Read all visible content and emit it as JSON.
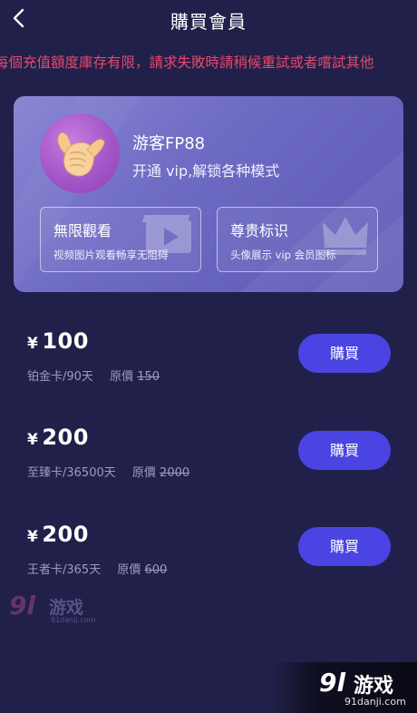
{
  "header": {
    "title": "購買會員",
    "back_icon": "chevron-left-icon"
  },
  "notice": "每個充值額度庫存有限，請求失敗時請稍候重試或者嚐試其他",
  "vip_card": {
    "user_name": "游客FP88",
    "description": "开通 vip,解锁各种模式",
    "avatar_icon": "hand-shaka-icon",
    "features": [
      {
        "title": "無限觀看",
        "desc": "视频图片观看畅享无阻碍",
        "icon": "film-icon"
      },
      {
        "title": "尊贵标识",
        "desc": "头像展示 vip 会员图标",
        "icon": "crown-icon"
      }
    ]
  },
  "plans": [
    {
      "currency": "¥",
      "price": "100",
      "name": "铂金卡/90天",
      "orig_label": "原價",
      "orig_price": "150",
      "button": "購買"
    },
    {
      "currency": "¥",
      "price": "200",
      "name": "至臻卡/36500天",
      "orig_label": "原價",
      "orig_price": "2000",
      "button": "購買"
    },
    {
      "currency": "¥",
      "price": "200",
      "name": "王者卡/365天",
      "orig_label": "原價",
      "orig_price": "600",
      "button": "購買"
    }
  ],
  "watermarks": [
    {
      "logo": "9l",
      "text": "游戏",
      "url": "91danji.com"
    },
    {
      "logo": "9l",
      "text": "游戏",
      "url": "91danji.com"
    }
  ],
  "colors": {
    "background": "#21204a",
    "card": "#6f6cc4",
    "button": "#4a44e3",
    "notice": "#e8476c"
  }
}
